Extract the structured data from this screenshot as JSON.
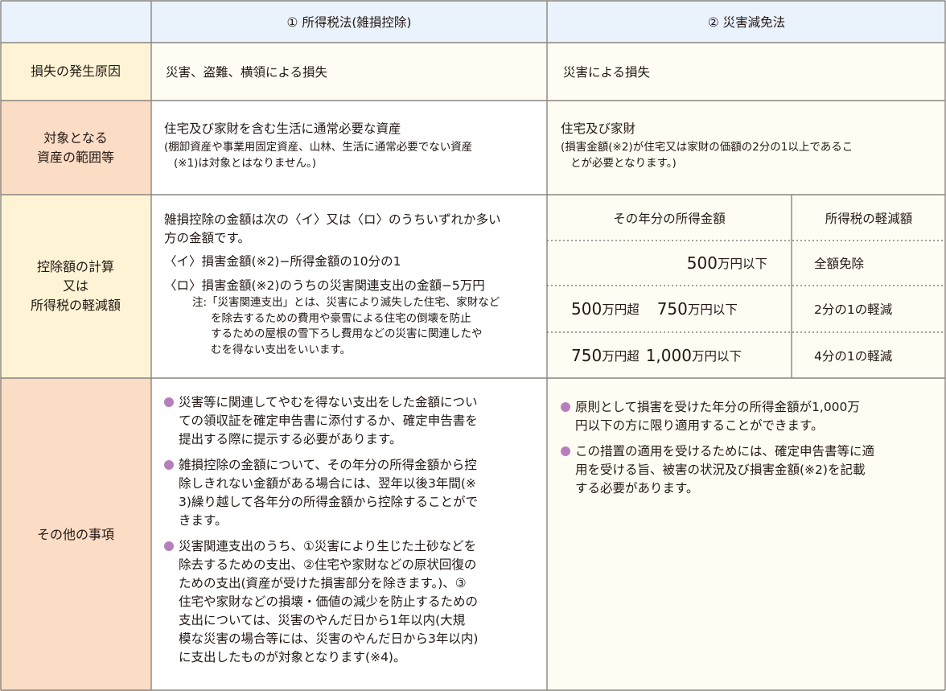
{
  "header": {
    "col1": "① 所得税法(雑損控除)",
    "col2": "② 災害減免法"
  },
  "rows": {
    "cause": {
      "label": "損失の発生原因",
      "col1": "災害、盗難、横領による損失",
      "col2": "災害による損失"
    },
    "assets": {
      "label_line1": "対象となる",
      "label_line2": "資産の範囲等",
      "col1_main": "住宅及び家財を含む生活に通常必要な資産",
      "col1_note_line1": "(棚卸資産や事業用固定資産、山林、生活に通常必要でない資産",
      "col1_note_line2": "(※1)は対象とはなりません。)",
      "col2_main": "住宅及び家財",
      "col2_note_line1": "(損害金額(※2)が住宅又は家財の価額の2分の1以上であるこ",
      "col2_note_line2": "とが必要となります。)"
    },
    "calc": {
      "label_line1": "控除額の計算",
      "label_line2": "又は",
      "label_line3": "所得税の軽減額",
      "intro_line1": "雑損控除の金額は次の〈イ〉又は〈ロ〉のうちいずれか多い",
      "intro_line2": "方の金額です。",
      "item_i": "〈イ〉損害金額(※2)−所得金額の10分の1",
      "item_ro": "〈ロ〉損害金額(※2)のうちの災害関連支出の金額−5万円",
      "note_line1": "注:「災害関連支出」とは、災害により滅失した住宅、家財など",
      "note_line2": "を除去するための費用や豪雪による住宅の倒壊を防止",
      "note_line3": "するための屋根の雪下ろし費用などの災害に関連したや",
      "note_line4": "むを得ない支出をいいます。",
      "table": {
        "head_income": "その年分の所得金額",
        "head_reduction": "所得税の軽減額",
        "r1_amount": "500",
        "r1_unit": "万円以下",
        "r1_reduction": "全額免除",
        "r2_from": "500",
        "r2_from_unit": "万円超",
        "r2_to": "750",
        "r2_to_unit": "万円以下",
        "r2_reduction": "2分の1の軽減",
        "r3_from": "750",
        "r3_from_unit": "万円超",
        "r3_to": "1,000",
        "r3_to_unit": "万円以下",
        "r3_reduction": "4分の1の軽減"
      }
    },
    "other": {
      "label": "その他の事項",
      "col1_b1": [
        "災害等に関連してやむを得ない支出をした金額につい",
        "ての領収証を確定申告書に添付するか、確定申告書を",
        "提出する際に提示する必要があります。"
      ],
      "col1_b2": [
        "雑損控除の金額について、その年分の所得金額から控",
        "除しきれない金額がある場合には、翌年以後3年間(※",
        "3)繰り越して各年分の所得金額から控除することがで",
        "きます。"
      ],
      "col1_b3": [
        "災害関連支出のうち、①災害により生じた土砂などを",
        "除去するための支出、②住宅や家財などの原状回復の",
        "ための支出(資産が受けた損害部分を除きます。)、③",
        "住宅や家財などの損壊・価値の減少を防止するための",
        "支出については、災害のやんだ日から1年以内(大規",
        "模な災害の場合等には、災害のやんだ日から3年以内)",
        "に支出したものが対象となります(※4)。"
      ],
      "col2_b1": [
        "原則として損害を受けた年分の所得金額が1,000万",
        "円以下の方に限り適用することができます。"
      ],
      "col2_b2": [
        "この措置の適用を受けるためには、確定申告書等に適",
        "用を受ける旨、被害の状況及び損害金額(※2)を記載",
        "する必要があります。"
      ]
    }
  },
  "colors": {
    "header_bg": "#eaf2fb",
    "rowhead_bg": "#fbdcc4",
    "rowhead_light_bg": "#fef4d5",
    "body_warm_bg": "#fffdf3",
    "bullet": "#b67fbc",
    "border": "#8a8580"
  }
}
